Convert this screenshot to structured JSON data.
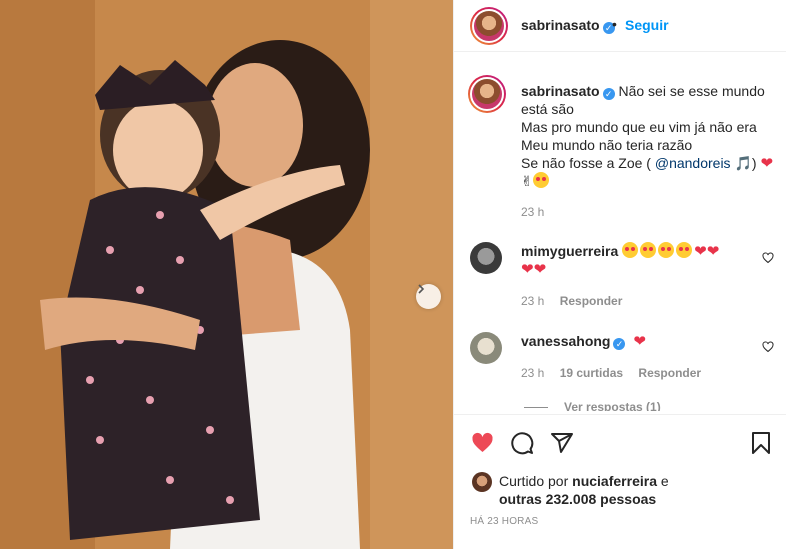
{
  "post": {
    "username": "sabrinasato",
    "follow_label": "Seguir",
    "separator": "•",
    "caption_lines": [
      "Não sei se esse mundo",
      "está são",
      "Mas pro mundo que eu vim já não era",
      "Meu mundo não teria razão",
      "Se não fosse a Zoe ("
    ],
    "mention": "@nandoreis",
    "caption_time": "23 h"
  },
  "comments": [
    {
      "user": "mimyguerreira",
      "time": "23 h",
      "reply_label": "Responder"
    },
    {
      "user": "vanessahong",
      "time": "23 h",
      "likes_label": "19 curtidas",
      "reply_label": "Responder"
    }
  ],
  "view_replies": "Ver respostas (1)",
  "likes": {
    "prefix": "Curtido por",
    "user": "nuciaferreira",
    "suffix": "e",
    "others": "outras 232.008 pessoas"
  },
  "timestamp": "HÁ 23 HORAS",
  "colors": {
    "accent": "#0095f6",
    "like": "#ed4956",
    "muted": "#8e8e8e"
  },
  "icons": [
    "chevron-right-icon",
    "verified-icon",
    "heart-icon",
    "comment-icon",
    "share-icon",
    "bookmark-icon"
  ]
}
